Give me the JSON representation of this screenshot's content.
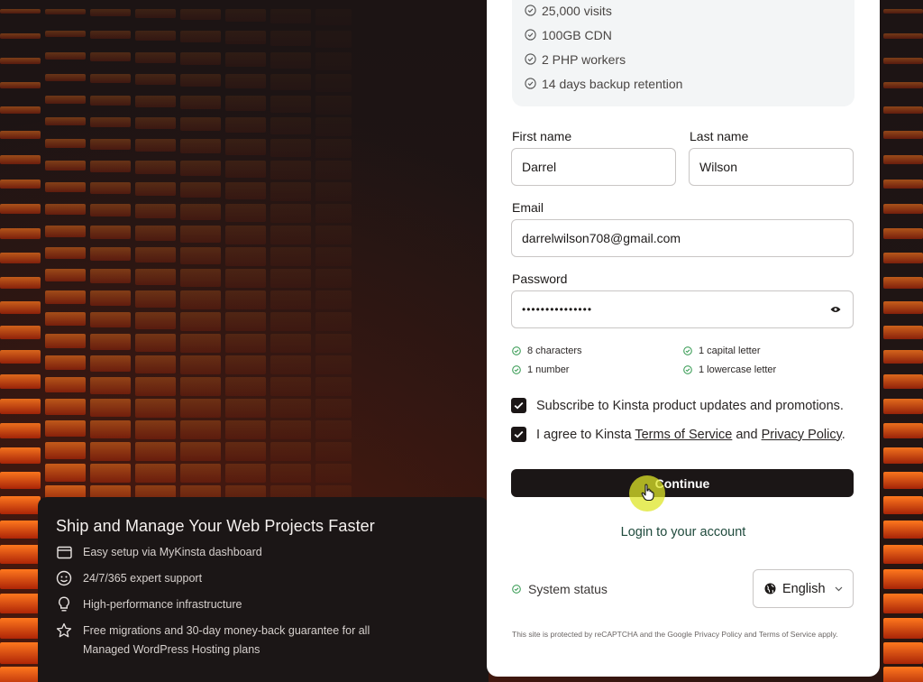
{
  "plan": {
    "features": [
      "25,000 visits",
      "100GB CDN",
      "2 PHP workers",
      "14 days backup retention"
    ]
  },
  "form": {
    "first_name_label": "First name",
    "first_name_value": "Darrel",
    "last_name_label": "Last name",
    "last_name_value": "Wilson",
    "email_label": "Email",
    "email_value": "darrelwilson708@gmail.com",
    "password_label": "Password",
    "password_value": "•••••••••••••••",
    "requirements": [
      "8 characters",
      "1 capital letter",
      "1 number",
      "1 lowercase letter"
    ],
    "subscribe_label": "Subscribe to Kinsta product updates and promotions.",
    "agree_prefix": "I agree to Kinsta ",
    "terms_link": "Terms of Service",
    "agree_and": " and ",
    "privacy_link": "Privacy Policy",
    "agree_suffix": ".",
    "continue_label": "Continue",
    "login_link": "Login to your account"
  },
  "footer": {
    "status_label": "System status",
    "language": "English",
    "recaptcha_text": "This site is protected by reCAPTCHA and the Google Privacy Policy and Terms of Service apply."
  },
  "info": {
    "title": "Ship and Manage Your Web Projects Faster",
    "features": [
      "Easy setup via MyKinsta dashboard",
      "24/7/365 expert support",
      "High-performance infrastructure",
      "Free migrations and 30-day money-back guarantee for all Managed WordPress Hosting plans"
    ]
  },
  "colors": {
    "accent_green": "#3f9f5a",
    "dark": "#1b1616",
    "bar_orange": "#ff5a12"
  }
}
